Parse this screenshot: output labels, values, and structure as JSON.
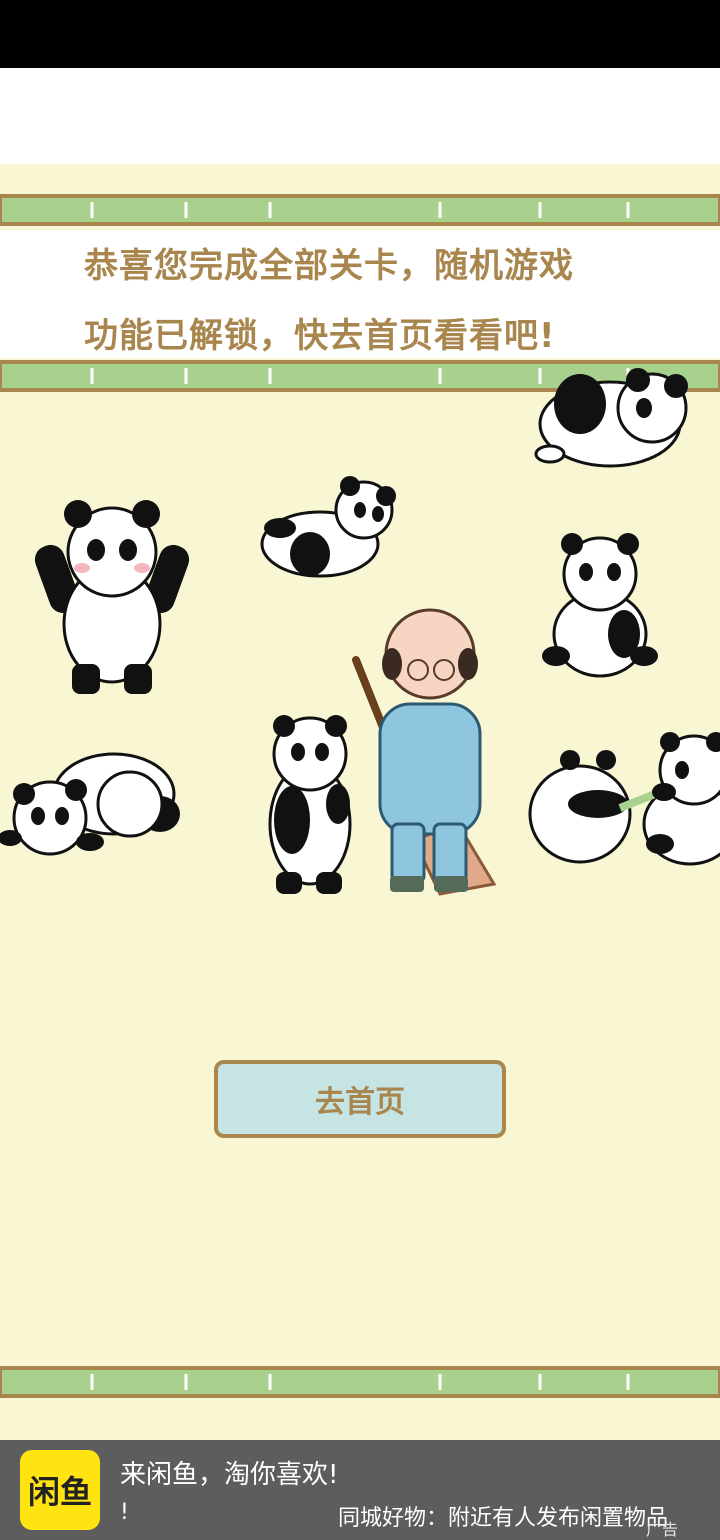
{
  "game": {
    "message_line1": "恭喜您完成全部关卡，随机游戏",
    "message_line2": "功能已解锁，快去首页看看吧!",
    "home_button_label": "去首页"
  },
  "ad": {
    "logo_text": "闲鱼",
    "title": "来闲鱼，淘你喜欢!",
    "exclaim": "!",
    "subtitle": "同城好物：附近有人发布闲置物品",
    "marker": "广告"
  },
  "colors": {
    "background": "#f8f6d3",
    "bamboo": "#a9d18e",
    "text_brown": "#a8864e",
    "button_fill": "#c6e4e4",
    "ad_bar": "#5d5d5d",
    "ad_logo": "#ffe411"
  }
}
